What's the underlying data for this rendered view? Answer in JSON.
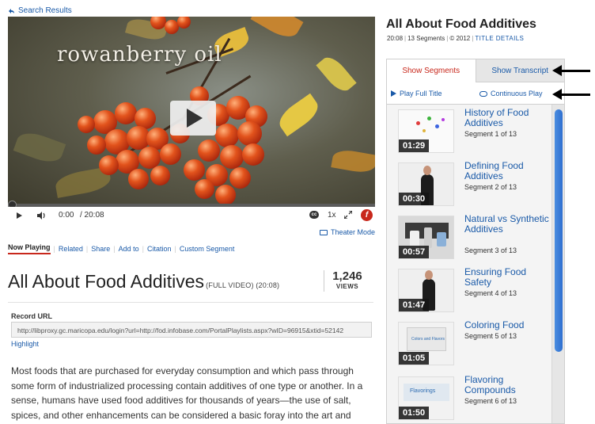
{
  "nav": {
    "back_label": "Search Results"
  },
  "video": {
    "overlay_text": "rowanberry oil",
    "current_time": "0:00",
    "total_time": "/ 20:08",
    "speed": "1x",
    "cc_label": "cc",
    "flash_label": "f",
    "theater_label": "Theater Mode"
  },
  "subtabs": [
    "Now Playing",
    "Related",
    "Share",
    "Add to",
    "Citation",
    "Custom Segment"
  ],
  "title": {
    "main": "All About Food Additives",
    "meta": "(FULL VIDEO) (20:08)",
    "views_count": "1,246",
    "views_label": "VIEWS"
  },
  "record": {
    "label": "Record URL",
    "url": "http://libproxy.gc.maricopa.edu/login?url=http://fod.infobase.com/PortalPlaylists.aspx?wID=96915&xtid=52142",
    "highlight_label": "Highlight"
  },
  "description": "Most foods that are purchased for everyday consumption and which pass through some form of industrialized processing contain additives of one type or another. In a sense, humans have used food additives for thousands of years—the use of salt, spices, and other enhancements can be considered a basic foray into the art and science of",
  "panel": {
    "title": "All About Food Additives",
    "duration": "20:08",
    "segments": "13 Segments",
    "year": "© 2012",
    "details_link": "TITLE DETAILS",
    "tab_segments": "Show Segments",
    "tab_transcript": "Show Transcript",
    "play_full": "Play Full Title",
    "continuous": "Continuous Play"
  },
  "segments": [
    {
      "name": "History of Food Additives",
      "num": "Segment 1 of 13",
      "dur": "01:29"
    },
    {
      "name": "Defining Food Additives",
      "num": "Segment 2 of 13",
      "dur": "00:30"
    },
    {
      "name": "Natural vs Synthetic Additives",
      "num": "Segment 3 of 13",
      "dur": "00:57"
    },
    {
      "name": "Ensuring Food Safety",
      "num": "Segment 4 of 13",
      "dur": "01:47"
    },
    {
      "name": "Coloring Food",
      "num": "Segment 5 of 13",
      "dur": "01:05"
    },
    {
      "name": "Flavoring Compounds",
      "num": "Segment 6 of 13",
      "dur": "01:50"
    }
  ],
  "thumb_texts": {
    "seg5": "Colors and Flavors",
    "seg6": "Flavorings"
  }
}
